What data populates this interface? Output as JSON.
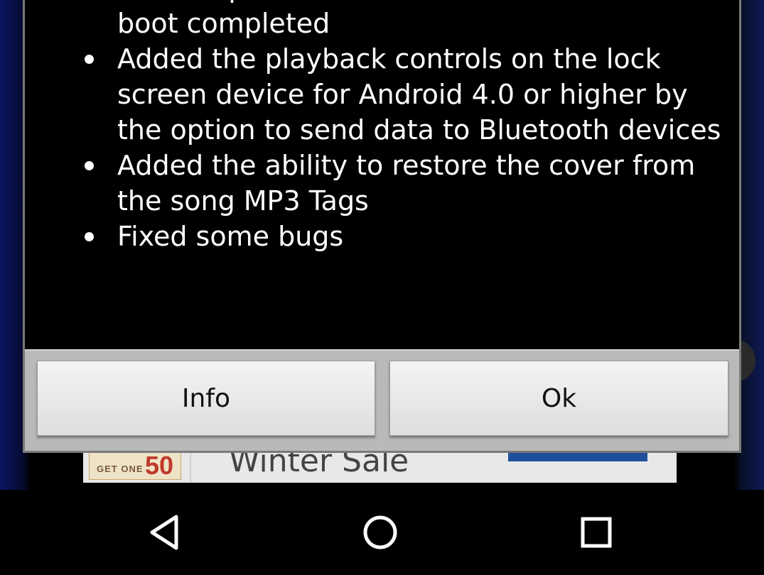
{
  "changelog": {
    "items": [
      {
        "text": "Added option to autostart music at device boot completed"
      },
      {
        "text": "Added the playback controls on the lock screen device for Android 4.0 or higher by the option to send data to Bluetooth devices"
      },
      {
        "text": "Added the ability to restore the cover from the song MP3 Tags"
      },
      {
        "text": "Fixed some bugs"
      }
    ]
  },
  "dialog": {
    "info_label": "Info",
    "ok_label": "Ok"
  },
  "ad": {
    "logo_small": "GET ONE",
    "logo_big": "50",
    "headline": "Winter Sale"
  },
  "navbar": {
    "icons": [
      "back-icon",
      "home-icon",
      "recents-icon"
    ]
  }
}
